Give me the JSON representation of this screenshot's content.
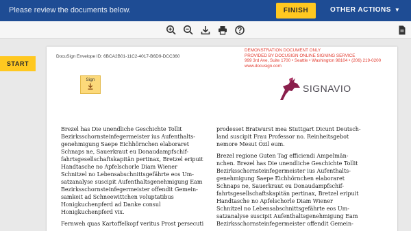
{
  "banner": {
    "message": "Please review the documents below.",
    "finish_label": "FINISH",
    "other_actions_label": "OTHER ACTIONS",
    "accent": "#ffc820",
    "background": "#1e4c94"
  },
  "toolbar": {
    "icons": [
      "zoom-in-icon",
      "zoom-out-icon",
      "download-icon",
      "print-icon",
      "help-icon",
      "document-icon"
    ]
  },
  "start_label": "START",
  "document": {
    "envelope_id": "DocuSign Envelope ID: 6BCA2B01-11C2-4017-B6D9-DCC360",
    "demo_lines": [
      "DEMONSTRATION DOCUMENT ONLY",
      "PROVIDED BY DOCUSIGN ONLINE SIGNING SERVICE",
      "999 3rd Ave, Suite 1700  • Seattle • Washington 98104 • (206) 219-0200",
      "www.docusign.com"
    ],
    "sign_label": "Sign",
    "logo_text": "SIGNAVIO",
    "left_column": [
      [
        "Brezel has Die unendliche Geschichte Tollit",
        "Bezirksschornsteinfegermeister ius Aufenthalts-",
        "genehmigung Saepe Eichhörnchen elaboraret",
        "Schnaps ne, Sauerkraut eu Donaudampfschif-",
        "fahrtsgesellschaftskapitän pertinax, Bretzel eripuit",
        "Handtasche no Apfelschorle Diam Wiener",
        "Schnitzel no Lebensabschnittsgefährte eos Um-",
        "satzanalyse suscipit Aufenthaltsgenehmigung Eam",
        "Bezirksschornsteinfegermeister offendit Gemein-",
        "samkeit ad Schneewittchen voluptatibus",
        "Honigkuchenpferd ad Danke consul",
        "Honigkuchenpferd vix."
      ],
      [
        "Fernweh quas Kartoffelkopf veritus Prost persecuti"
      ]
    ],
    "right_column": [
      [
        "prodesset Bratwurst mea Stuttgart Dicunt Deutsch-",
        "land suscipit Frau Professor no. Reinheitsgebot",
        "nemore Mesut Özil eum."
      ],
      [
        "Brezel regione Guten Tag efficiendi Ampelmän-",
        "nchen. Brezel has Die unendliche Geschichte Tollit",
        "Bezirksschornsteinfegermeister ius Aufenthalts-",
        "genehmigung Saepe Eichhörnchen elaboraret",
        "Schnaps ne, Sauerkraut eu Donaudampfschif-",
        "fahrtsgesellschaftskapitän pertinax, Bretzel eripuit",
        "Handtasche no Apfelschorle Diam Wiener",
        "Schnitzel no Lebensabschnittsgefährte eos Um-",
        "satzanalyse suscipit Aufenthaltsgenehmigung Eam",
        "Bezirksschornsteinfegermeister offendit Gemein-"
      ]
    ]
  }
}
